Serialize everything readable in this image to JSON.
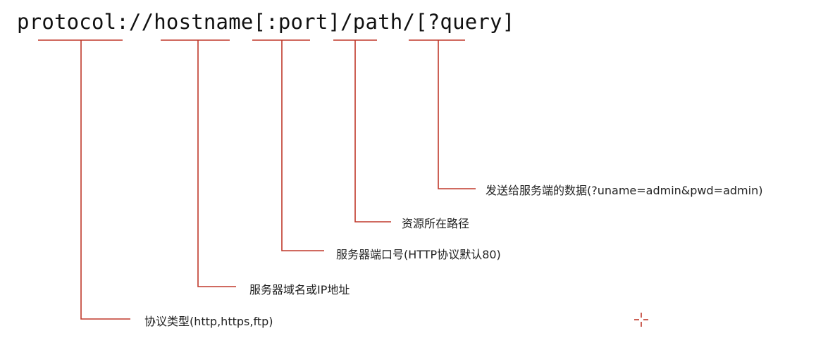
{
  "url_pattern": "protocol://hostname[:port]/path/[?query]",
  "annotations": {
    "query": "发送给服务端的数据(?uname=admin&pwd=admin)",
    "path": "资源所在路径",
    "port": "服务器端口号(HTTP协议默认80)",
    "hostname": "服务器域名或IP地址",
    "protocol": "协议类型(http,https,ftp)"
  },
  "colors": {
    "line": "#c0392b",
    "text": "#111111"
  }
}
